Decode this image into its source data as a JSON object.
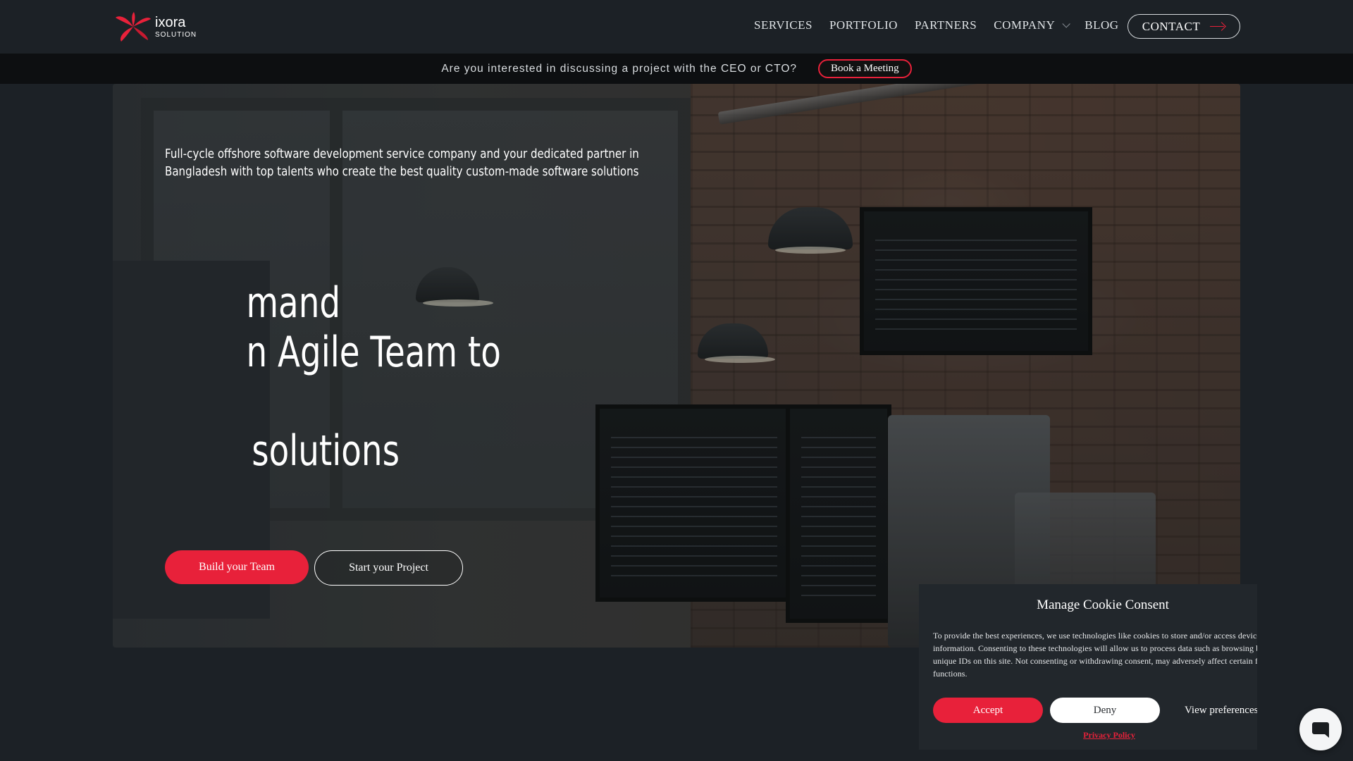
{
  "header": {
    "logo": {
      "name": "ixora-logo-icon",
      "main_text": "ixora",
      "sub_text": "SOLUTION"
    },
    "nav": [
      {
        "label": "SERVICES"
      },
      {
        "label": "PORTFOLIO"
      },
      {
        "label": "PARTNERS"
      },
      {
        "label": "COMPANY",
        "dropdown": true
      },
      {
        "label": "BLOG"
      }
    ],
    "contact_label": "CONTACT"
  },
  "announcement": {
    "text": "Are you interested in discussing a project with the CEO or CTO?",
    "button_label": "Book a Meeting"
  },
  "hero": {
    "description": "Full-cycle offshore software development service company and your dedicated partner in Bangladesh with top talents who create the best quality custom-made software solutions",
    "heading_lines": [
      "mand",
      "n Agile Team to",
      "",
      "solutions"
    ],
    "primary_button": "Build your Team",
    "secondary_button": "Start your Project"
  },
  "cookie": {
    "title": "Manage Cookie Consent",
    "text": "To provide the best experiences, we use technologies like cookies to store and/or access device information. Consenting to these technologies will allow us to process data such as browsing behavior or unique IDs on this site. Not consenting or withdrawing consent, may adversely affect certain features and functions.",
    "accept_label": "Accept",
    "deny_label": "Deny",
    "view_label": "View preferences",
    "policy_label": "Privacy Policy"
  },
  "chat": {
    "icon": "chat-bubble-icon"
  },
  "colors": {
    "accent": "#e8213a",
    "background": "#1c2126",
    "announce_bg": "#0d0f11",
    "cookie_bg": "#22272c"
  }
}
